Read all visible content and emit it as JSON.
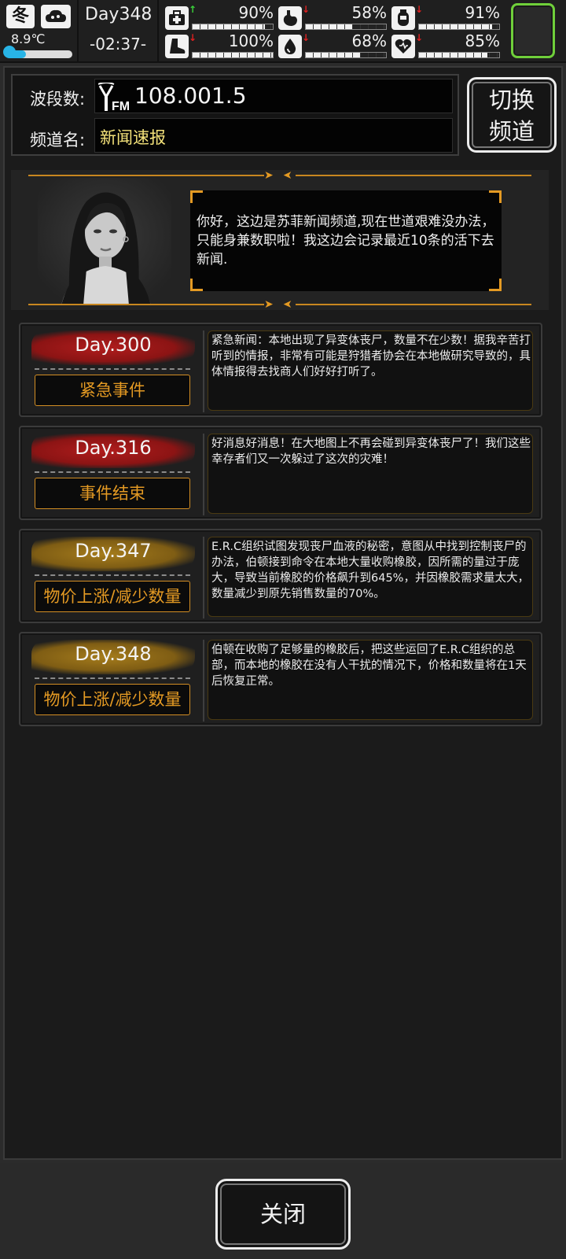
{
  "status": {
    "season": "冬",
    "temperature": "8.9℃",
    "temperature_level": 0.3,
    "day": "Day348",
    "time": "-02:37-",
    "stats": [
      {
        "name": "health",
        "icon": "medkit-icon",
        "trend": "up",
        "value": "90%",
        "level": 0.9
      },
      {
        "name": "hunger",
        "icon": "stomach-icon",
        "trend": "down",
        "value": "58%",
        "level": 0.58
      },
      {
        "name": "stamina",
        "icon": "canister-icon",
        "trend": "down",
        "value": "91%",
        "level": 0.91
      },
      {
        "name": "endurance",
        "icon": "boot-icon",
        "trend": "down",
        "value": "100%",
        "level": 1.0
      },
      {
        "name": "thirst",
        "icon": "water-drop-icon",
        "trend": "down",
        "value": "68%",
        "level": 0.68
      },
      {
        "name": "mood",
        "icon": "heart-icon",
        "trend": "down",
        "value": "85%",
        "level": 0.85
      }
    ],
    "colors": {
      "trend_up": "#3ad43a",
      "trend_down": "#e02020",
      "temp_fill": "#28b4e6",
      "slot_border": "#6fcf3a"
    }
  },
  "radio": {
    "band_label": "波段数:",
    "frequency": "108.001.5",
    "channel_label": "频道名:",
    "channel_name": "新闻速报",
    "switch_button": "切换\n频道"
  },
  "reporter": {
    "message": "你好，这边是苏菲新闻频道,现在世道艰难没办法，只能身兼数职啦！我这边会记录最近10条的活下去新闻."
  },
  "news": [
    {
      "day": "Day.300",
      "tag": "紧急事件",
      "color": "red",
      "text": "紧急新闻：本地出现了异变体丧尸，数量不在少数！据我辛苦打听到的情报，非常有可能是狩猎者协会在本地做研究导致的，具体情报得去找商人们好好打听了。"
    },
    {
      "day": "Day.316",
      "tag": "事件结束",
      "color": "red",
      "text": "好消息好消息！在大地图上不再会碰到异变体丧尸了！我们这些幸存者们又一次躲过了这次的灾难！"
    },
    {
      "day": "Day.347",
      "tag": "物价上涨/减少数量",
      "color": "gold",
      "text": "E.R.C组织试图发现丧尸血液的秘密，意图从中找到控制丧尸的办法，伯顿接到命令在本地大量收购橡胶，因所需的量过于庞大，导致当前橡胶的价格飙升到645%，并因橡胶需求量太大，数量减少到原先销售数量的70%。"
    },
    {
      "day": "Day.348",
      "tag": "物价上涨/减少数量",
      "color": "gold",
      "text": "伯顿在收购了足够量的橡胶后，把这些运回了E.R.C组织的总部，而本地的橡胶在没有人干扰的情况下，价格和数量将在1天后恢复正常。"
    }
  ],
  "footer": {
    "close_button": "关闭"
  }
}
